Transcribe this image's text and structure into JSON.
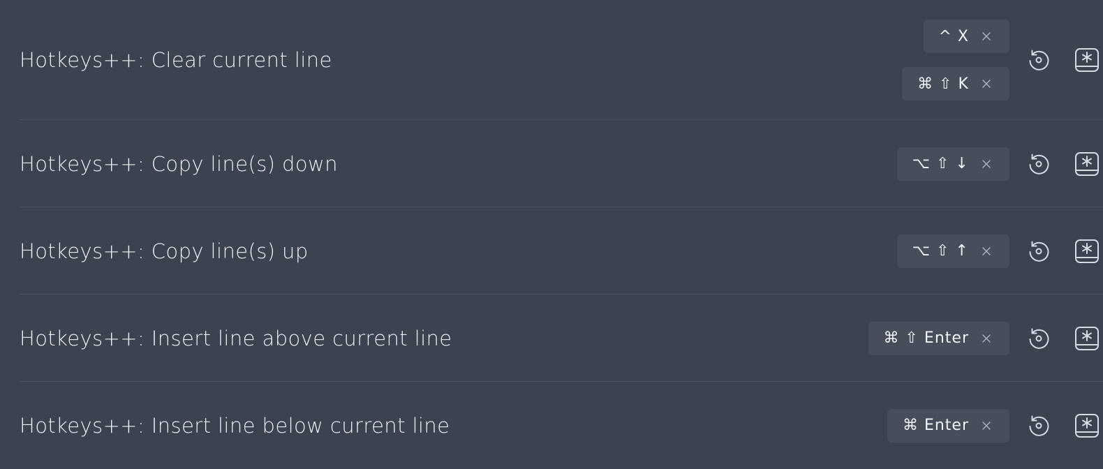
{
  "rows": [
    {
      "name": "Hotkeys++: Clear current line",
      "hotkeys": [
        "^ X",
        "⌘ ⇧ K"
      ]
    },
    {
      "name": "Hotkeys++: Copy line(s) down",
      "hotkeys": [
        "⌥ ⇧ ↓"
      ]
    },
    {
      "name": "Hotkeys++: Copy line(s) up",
      "hotkeys": [
        "⌥ ⇧ ↑"
      ]
    },
    {
      "name": "Hotkeys++: Insert line above current line",
      "hotkeys": [
        "⌘ ⇧ Enter"
      ]
    },
    {
      "name": "Hotkeys++: Insert line below current line",
      "hotkeys": [
        "⌘ Enter"
      ]
    }
  ],
  "icons": {
    "remove": "close-icon",
    "restore": "restore-default-icon",
    "add": "add-hotkey-icon"
  },
  "colors": {
    "background": "#3b4250",
    "hotkey_background": "#464e5c",
    "divider": "#4a5261",
    "text": "#eceff3"
  }
}
